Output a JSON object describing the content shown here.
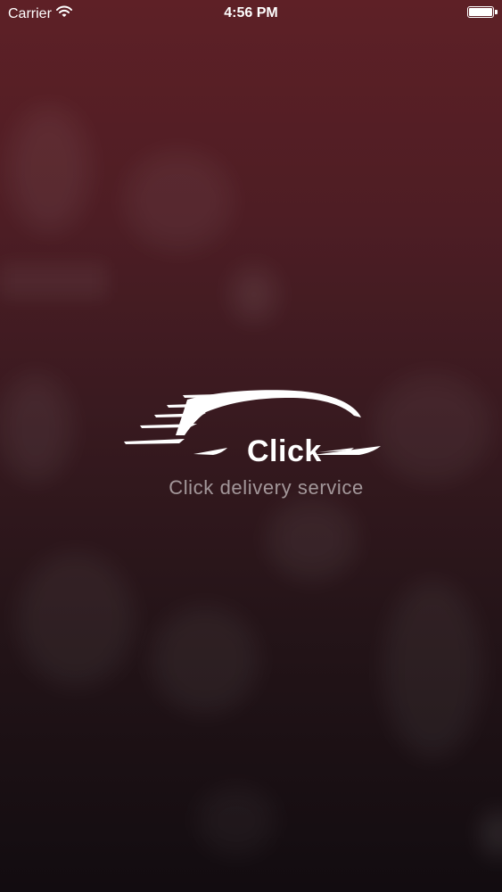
{
  "status_bar": {
    "carrier": "Carrier",
    "time": "4:56 PM",
    "battery_level": 1.0
  },
  "splash": {
    "brand": "Click",
    "tagline": "Click delivery service",
    "logo_icon": "car-speed-icon"
  },
  "colors": {
    "background_top": "#5e2026",
    "background_bottom": "#120c10",
    "text": "#ffffff"
  }
}
